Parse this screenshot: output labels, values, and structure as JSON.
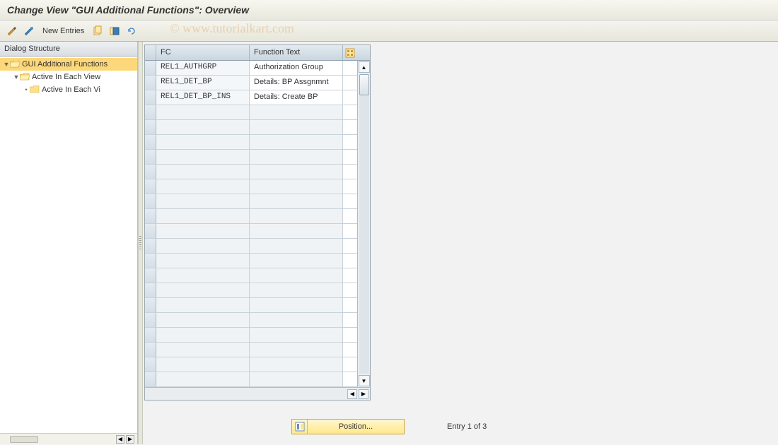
{
  "title": "Change View \"GUI Additional Functions\": Overview",
  "watermark": "© www.tutorialkart.com",
  "toolbar": {
    "new_entries_label": "New Entries"
  },
  "sidebar": {
    "header": "Dialog Structure",
    "items": [
      {
        "label": "GUI Additional Functions",
        "level": 0,
        "selected": true,
        "open": true
      },
      {
        "label": "Active In Each View",
        "level": 1,
        "selected": false,
        "open": true
      },
      {
        "label": "Active In Each Vi",
        "level": 2,
        "selected": false,
        "open": false
      }
    ]
  },
  "grid": {
    "columns": {
      "fc": "FC",
      "ftext": "Function Text"
    },
    "rows": [
      {
        "fc": "REL1_AUTHGRP",
        "ftext": "Authorization Group"
      },
      {
        "fc": "REL1_DET_BP",
        "ftext": "Details: BP Assgnmnt"
      },
      {
        "fc": "REL1_DET_BP_INS",
        "ftext": "Details: Create BP"
      }
    ],
    "empty_rows": 19
  },
  "footer": {
    "position_label": "Position...",
    "entry_text": "Entry 1 of 3"
  }
}
